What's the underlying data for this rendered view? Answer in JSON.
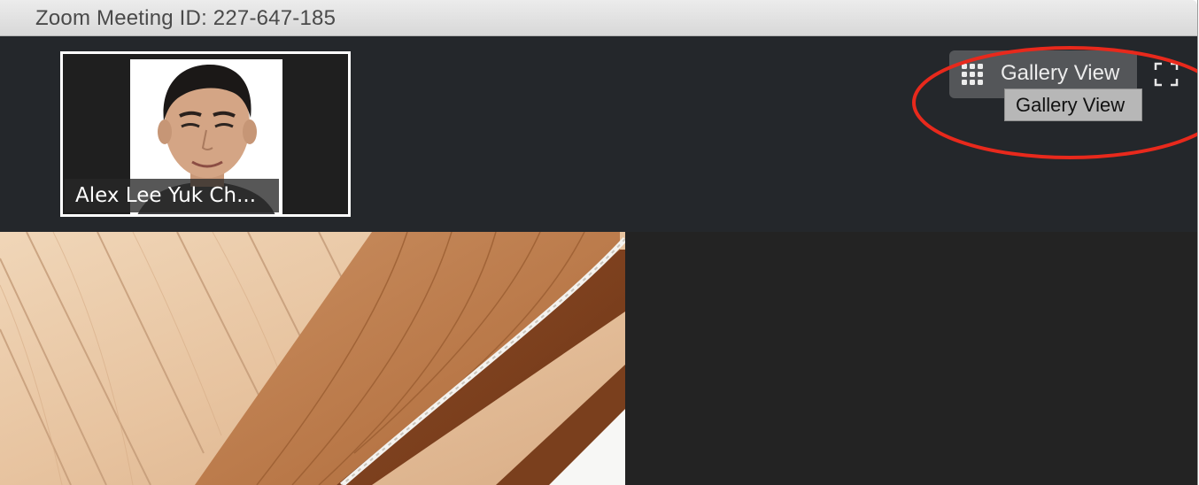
{
  "window": {
    "title": "Zoom Meeting ID: 227-647-185"
  },
  "participant_strip": {
    "thumbnail": {
      "name": "Alex Lee Yuk Ch..."
    }
  },
  "view_controls": {
    "gallery_view_label": "Gallery View",
    "gallery_view_icon": "grid-icon",
    "fullscreen_icon": "fullscreen-icon",
    "tooltip_text": "Gallery View"
  },
  "annotation": {
    "highlight_color": "#e8291c"
  },
  "colors": {
    "strip_background": "#24272b",
    "stage_background": "#232323",
    "button_background": "#545659",
    "tooltip_background": "#b7b7b7"
  }
}
